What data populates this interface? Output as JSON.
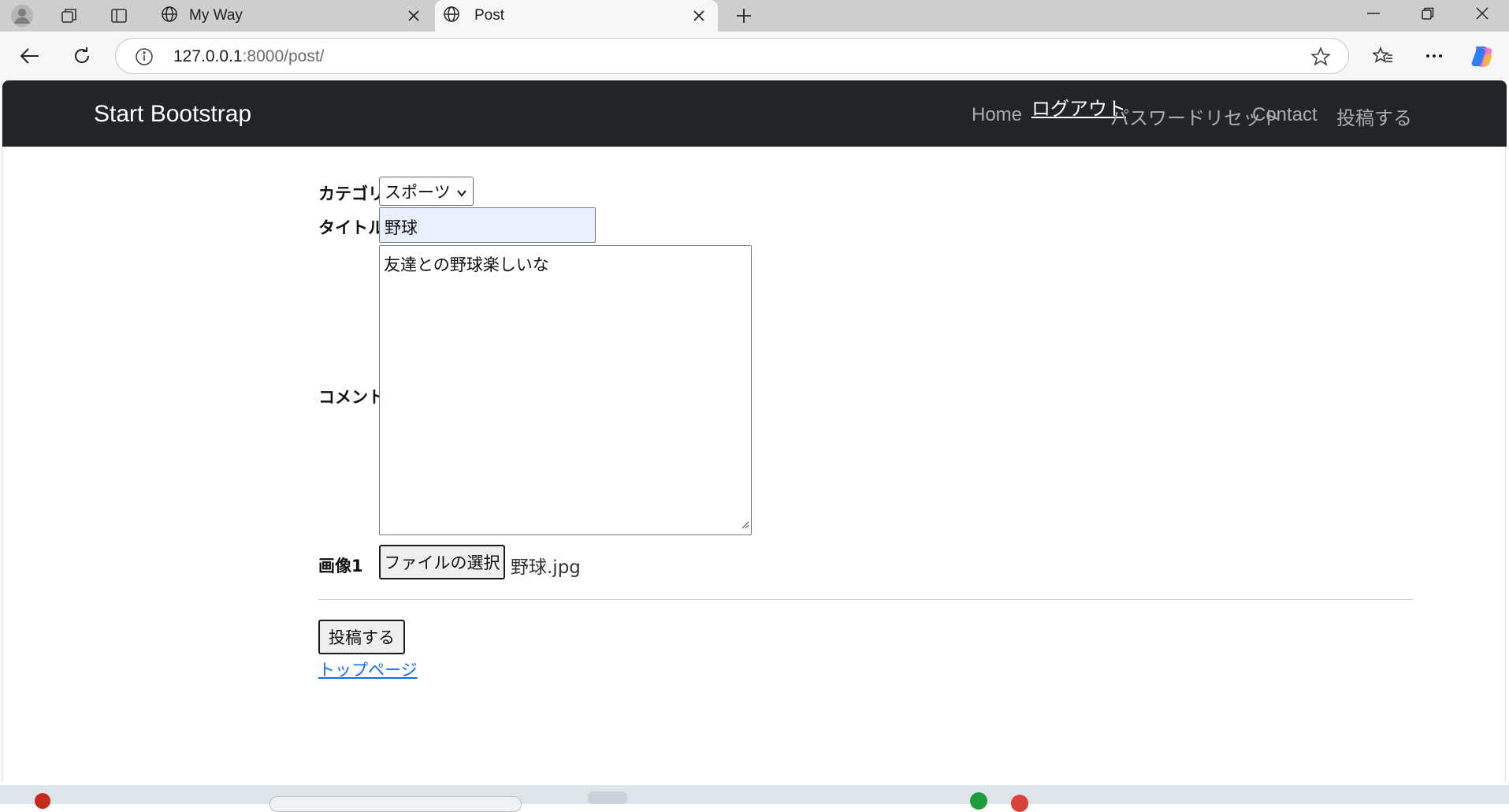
{
  "browser": {
    "tabs": [
      {
        "title": "My Way",
        "active": false
      },
      {
        "title": "Post",
        "active": true
      }
    ],
    "address": {
      "host": "127.0.0.1",
      "rest": ":8000/post/"
    }
  },
  "site": {
    "brand": "Start Bootstrap",
    "nav": {
      "home": "Home",
      "logout": "ログアウト",
      "password_reset": "パスワードリセット",
      "contact": "Contact",
      "post": "投稿する"
    }
  },
  "form": {
    "category_label": "カテゴリ",
    "category_value": "スポーツ",
    "title_label": "タイトル",
    "title_value": "野球",
    "comment_label": "コメント",
    "comment_value": "友達との野球楽しいな",
    "image_label": "画像1",
    "file_button": "ファイルの選択",
    "file_name": "野球.jpg",
    "submit": "投稿する",
    "top_link": "トップページ"
  },
  "colors": {
    "navbar_bg": "#212529",
    "link": "#0d6efd",
    "autofill_bg": "#e8f0fe"
  }
}
